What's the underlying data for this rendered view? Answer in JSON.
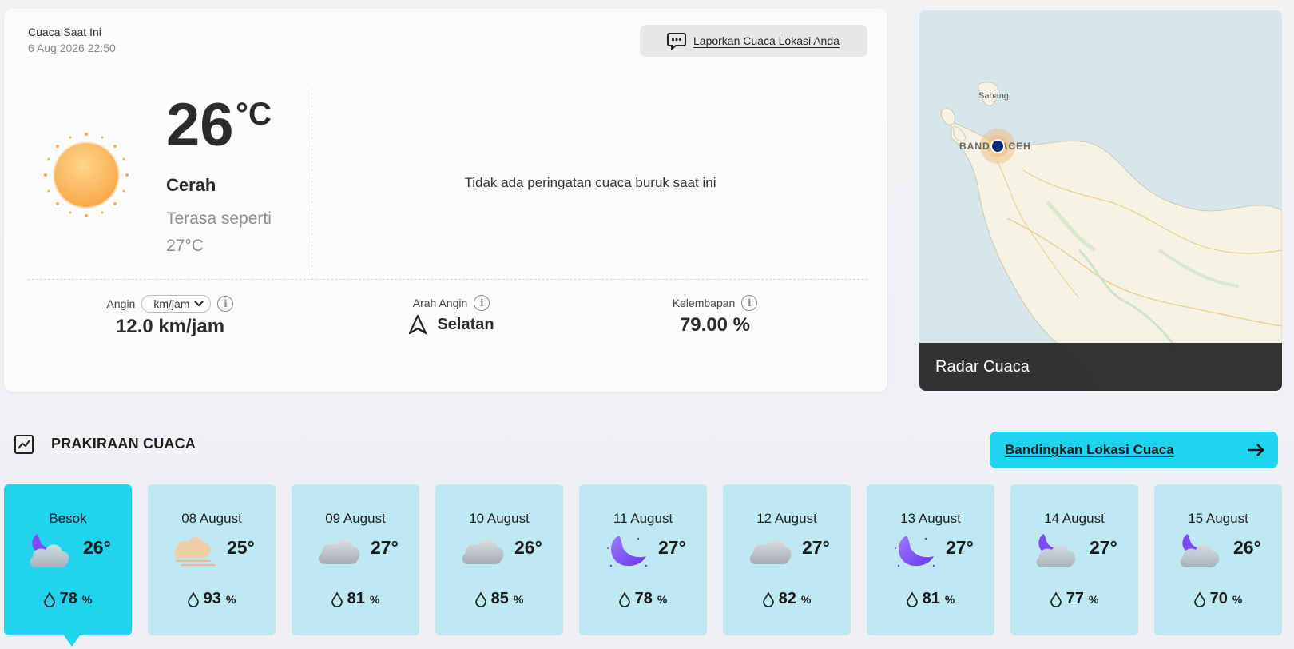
{
  "current": {
    "label": "Cuaca Saat Ini",
    "datetime": "6 Aug 2026 22:50",
    "report_button": "Laporkan Cuaca Lokasi Anda",
    "temperature": "26",
    "temp_unit": "°C",
    "condition": "Cerah",
    "feels_like": "Terasa seperti 27°C",
    "warning": "Tidak ada peringatan cuaca buruk saat ini",
    "wind_label": "Angin",
    "wind_unit_option": "km/jam",
    "wind_value": "12.0 km/jam",
    "wind_dir_label": "Arah Angin",
    "wind_dir_value": "Selatan",
    "humidity_label": "Kelembapan",
    "humidity_value": "79.00 %"
  },
  "map": {
    "radar_label": "Radar Cuaca",
    "places": [
      "Sabang",
      "BANDA ACEH"
    ]
  },
  "forecast": {
    "title": "PRAKIRAAN CUACA",
    "compare_button": "Bandingkan Lokasi Cuaca",
    "pct_symbol": "%",
    "days": [
      {
        "date": "Besok",
        "temp": "26°",
        "humidity": "78",
        "icon": "night-cloudy-icon",
        "active": true
      },
      {
        "date": "08 August",
        "temp": "25°",
        "humidity": "93",
        "icon": "haze-icon"
      },
      {
        "date": "09 August",
        "temp": "27°",
        "humidity": "81",
        "icon": "cloud-icon"
      },
      {
        "date": "10 August",
        "temp": "26°",
        "humidity": "85",
        "icon": "cloud-icon"
      },
      {
        "date": "11 August",
        "temp": "27°",
        "humidity": "78",
        "icon": "moon-icon"
      },
      {
        "date": "12 August",
        "temp": "27°",
        "humidity": "82",
        "icon": "cloud-icon"
      },
      {
        "date": "13 August",
        "temp": "27°",
        "humidity": "81",
        "icon": "moon-icon"
      },
      {
        "date": "14 August",
        "temp": "27°",
        "humidity": "77",
        "icon": "night-cloudy-icon"
      },
      {
        "date": "15 August",
        "temp": "26°",
        "humidity": "70",
        "icon": "night-cloudy-icon"
      }
    ]
  },
  "colors": {
    "accent": "#22d3ee",
    "card_bg": "#bfe9f2",
    "sun": "#f8a94b",
    "moon": "#7b4cf5"
  }
}
